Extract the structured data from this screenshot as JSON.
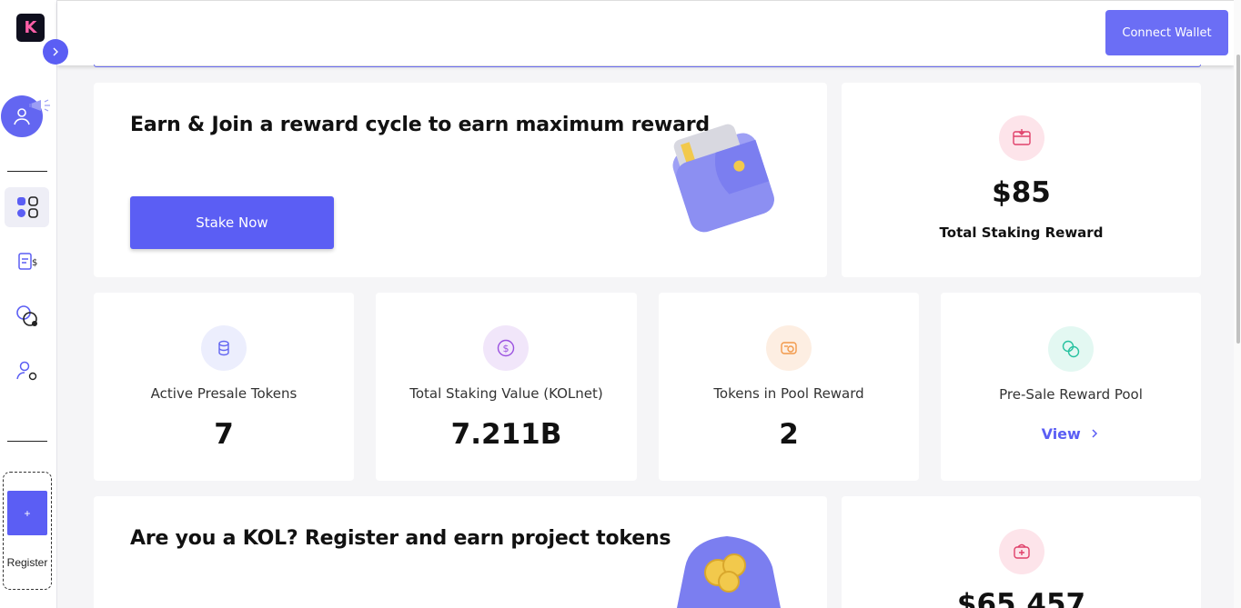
{
  "header": {
    "connect_label": "Connect Wallet"
  },
  "sidebar": {
    "logo_letter": "K",
    "items": [
      {
        "icon": "dashboard-grid-icon"
      },
      {
        "icon": "clipboard-dollar-icon"
      },
      {
        "icon": "link-rings-icon"
      },
      {
        "icon": "user-settings-icon"
      }
    ],
    "register_plus": "+",
    "register_label": "Register"
  },
  "hero": {
    "title": "Earn & Join a reward cycle to earn maximum reward",
    "button": "Stake Now"
  },
  "total_reward": {
    "value": "$85",
    "label": "Total Staking Reward"
  },
  "stats": [
    {
      "label": "Active Presale Tokens",
      "value": "7",
      "icon": "coins-icon"
    },
    {
      "label": "Total Staking Value (KOLnet)",
      "value": "7.211B",
      "icon": "dollar-circle-icon"
    },
    {
      "label": "Tokens in Pool Reward",
      "value": "2",
      "icon": "pool-coins-icon"
    },
    {
      "label": "Pre-Sale Reward Pool",
      "link": "View",
      "icon": "chain-link-icon"
    }
  ],
  "kol": {
    "title": "Are you a KOL? Register and earn project tokens"
  },
  "bottom_reward": {
    "value": "$65,457"
  },
  "colors": {
    "accent": "#5b5ef4",
    "background": "#f5f5f7"
  }
}
